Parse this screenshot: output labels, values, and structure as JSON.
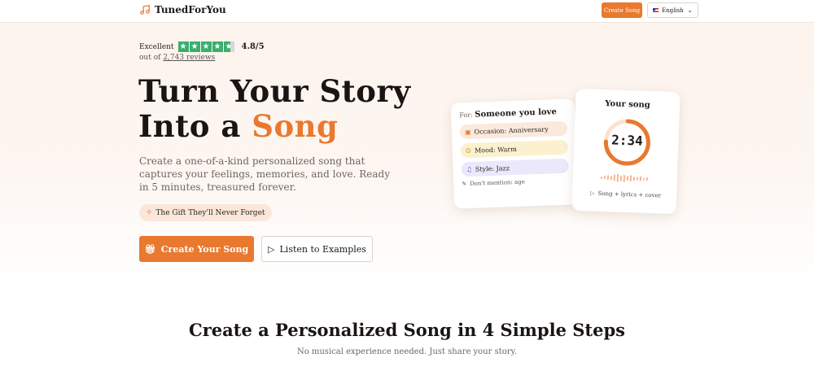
{
  "header": {
    "brand": "TunedForYou",
    "cta_label": "Create Song",
    "language": "English"
  },
  "rating": {
    "label": "Excellent",
    "score": "4.8/5",
    "stars": 4.8,
    "reviews_prefix": "out of",
    "reviews_count": "2,743 reviews",
    "color": "#3aae6e"
  },
  "hero": {
    "title_line1": "Turn Your Story",
    "title_line2_pre": "Into a",
    "title_line2_accent": "Song",
    "subtitle": "Create a one-of-a-kind personalized song that captures your feelings, memories, and love. Ready in 5 minutes, treasured forever.",
    "pill": "The Gift They'll Never Forget",
    "primary_button": "Create Your Song",
    "secondary_button": "Listen to Examples",
    "accent_color": "#e8792f"
  },
  "card_form": {
    "for_label": "For:",
    "for_value": "Someone you love",
    "occasion": "Occasion: Anniversary",
    "mood": "Mood: Warm",
    "style": "Style: Jazz",
    "dont_mention": "Don't mention: age"
  },
  "card_song": {
    "title": "Your song",
    "duration": "2:34",
    "progress": 0.75,
    "caption": "Song + lyrics + cover"
  },
  "steps": {
    "title": "Create a Personalized Song in 4 Simple Steps",
    "subtitle": "No musical experience needed. Just share your story."
  }
}
